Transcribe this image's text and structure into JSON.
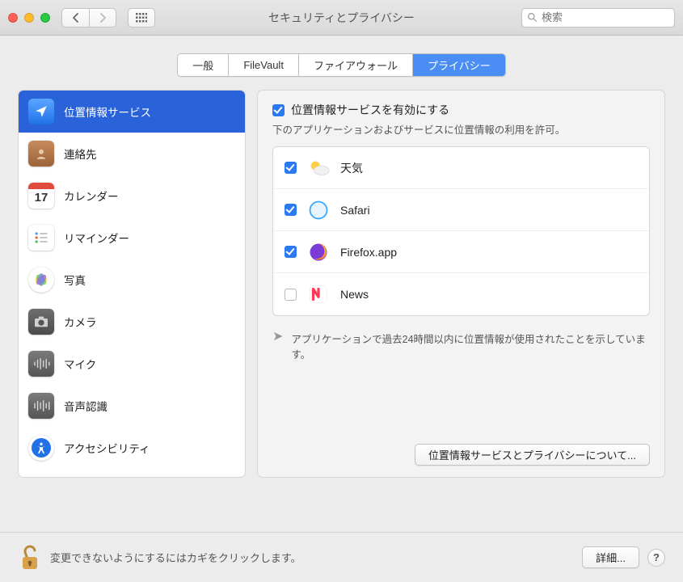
{
  "window": {
    "title": "セキュリティとプライバシー",
    "search_placeholder": "検索"
  },
  "tabs": [
    {
      "label": "一般"
    },
    {
      "label": "FileVault"
    },
    {
      "label": "ファイアウォール"
    },
    {
      "label": "プライバシー"
    }
  ],
  "sidebar": {
    "items": [
      {
        "label": "位置情報サービス",
        "icon": "location-icon",
        "selected": true
      },
      {
        "label": "連絡先",
        "icon": "contacts-icon"
      },
      {
        "label": "カレンダー",
        "icon": "calendar-icon",
        "day": "17"
      },
      {
        "label": "リマインダー",
        "icon": "reminders-icon"
      },
      {
        "label": "写真",
        "icon": "photos-icon"
      },
      {
        "label": "カメラ",
        "icon": "camera-icon"
      },
      {
        "label": "マイク",
        "icon": "mic-icon"
      },
      {
        "label": "音声認識",
        "icon": "speech-icon"
      },
      {
        "label": "アクセシビリティ",
        "icon": "accessibility-icon"
      }
    ]
  },
  "main": {
    "enable_label": "位置情報サービスを有効にする",
    "subtext": "下のアプリケーションおよびサービスに位置情報の利用を許可。",
    "apps": [
      {
        "name": "天気",
        "icon": "weather-icon",
        "checked": true
      },
      {
        "name": "Safari",
        "icon": "safari-icon",
        "checked": true
      },
      {
        "name": "Firefox.app",
        "icon": "firefox-icon",
        "checked": true
      },
      {
        "name": "News",
        "icon": "news-icon",
        "checked": false
      }
    ],
    "note": "アプリケーションで過去24時間以内に位置情報が使用されたことを示しています。",
    "about_button": "位置情報サービスとプライバシーについて..."
  },
  "footer": {
    "text": "変更できないようにするにはカギをクリックします。",
    "advanced_button": "詳細...",
    "help": "?"
  }
}
